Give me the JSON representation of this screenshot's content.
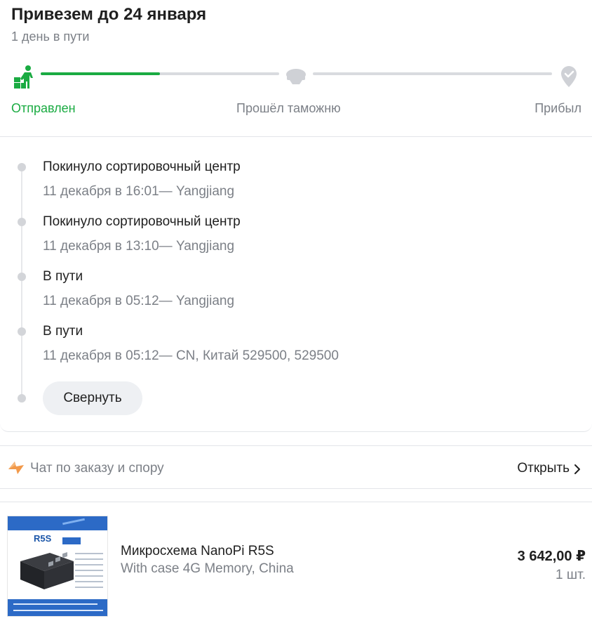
{
  "delivery": {
    "title": "Привезем до 24 января",
    "subtitle": "1 день в пути",
    "progress_fraction": 0.5,
    "steps": [
      {
        "label": "Отправлен",
        "icon": "worker-with-boxes-icon",
        "state": "done"
      },
      {
        "label": "Прошёл таможню",
        "icon": "customs-officer-cap-icon",
        "state": "pending"
      },
      {
        "label": "Прибыл",
        "icon": "location-pin-check-icon",
        "state": "pending"
      }
    ],
    "active_color": "#1aab42",
    "inactive_color": "#d9dbdf"
  },
  "timeline": {
    "events": [
      {
        "title": "Покинуло сортировочный центр",
        "meta": "11 декабря в 16:01— Yangjiang"
      },
      {
        "title": "Покинуло сортировочный центр",
        "meta": "11 декабря в 13:10— Yangjiang"
      },
      {
        "title": "В пути",
        "meta": "11 декабря в 05:12— Yangjiang"
      },
      {
        "title": "В пути",
        "meta": "11 декабря в 05:12— CN, Китай 529500, 529500"
      }
    ],
    "collapse_label": "Свернуть"
  },
  "chat": {
    "icon": "lightning-chat-icon",
    "label": "Чат по заказу и спору",
    "open_label": "Открыть"
  },
  "product": {
    "image_label": "R5S",
    "name": "Микросхема NanoPi R5S",
    "variant": "With case 4G Memory, China",
    "price": "3 642,00 ₽",
    "quantity": "1 шт."
  }
}
